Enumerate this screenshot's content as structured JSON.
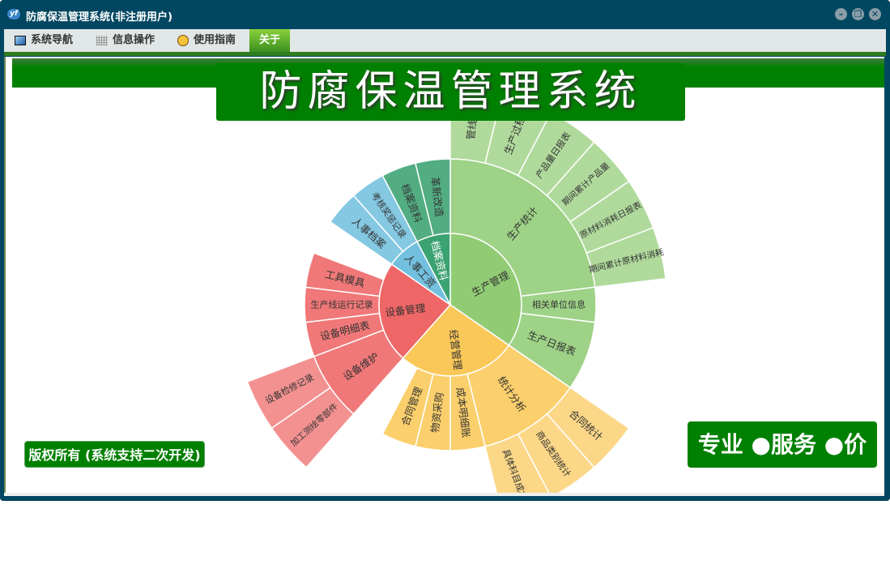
{
  "window": {
    "title": "防腐保温管理系统(非注册用户)",
    "logo": "yf",
    "controls": [
      "minimize-icon",
      "restore-icon",
      "close-icon"
    ]
  },
  "menu": [
    {
      "label": "系统导航",
      "icon": "monitor-icon"
    },
    {
      "label": "信息操作",
      "icon": "grid-icon"
    },
    {
      "label": "使用指南",
      "icon": "help-icon"
    },
    {
      "label": "关于",
      "active": true
    }
  ],
  "banner": {
    "title": "防腐保温管理系统"
  },
  "footer": {
    "copyright": "版权所有 (系统支持二次开发)",
    "slogan": "专业 ●服务 ●价值"
  },
  "colors": {
    "frame": "#024761",
    "green": "#008000"
  },
  "chart_data": {
    "type": "sunburst",
    "start_angle": "top, clockwise",
    "children": [
      {
        "name": "生产管理",
        "value": 9,
        "color": "#91cc75",
        "children": [
          {
            "name": "生产统计",
            "value": 6,
            "children": [
              {
                "name": "管线进",
                "value": 1
              },
              {
                "name": "生产过程",
                "value": 1
              },
              {
                "name": "产品量日报表",
                "value": 1
              },
              {
                "name": "期间累计产品量",
                "value": 1
              },
              {
                "name": "原材料消耗日报表",
                "value": 1
              },
              {
                "name": "期间累计原材料消耗",
                "value": 1
              }
            ]
          },
          {
            "name": "相关单位信息",
            "value": 1
          },
          {
            "name": "生产日报表",
            "value": 2
          }
        ]
      },
      {
        "name": "经营管理",
        "value": 7,
        "color": "#fac858",
        "children": [
          {
            "name": "统计分析",
            "value": 3,
            "children": [
              {
                "name": "合同统计",
                "value": 1
              },
              {
                "name": "商品类别统计",
                "value": 1
              },
              {
                "name": "具体科目成本",
                "value": 1
              }
            ]
          },
          {
            "name": "成本明细账",
            "value": 1
          },
          {
            "name": "物资采购",
            "value": 1
          },
          {
            "name": "合同管理",
            "value": 1
          }
        ]
      },
      {
        "name": "设备管理",
        "value": 6,
        "color": "#ee6666",
        "children": [
          {
            "name": "设备维护",
            "value": 2,
            "children": [
              {
                "name": "加工测绘零部件",
                "value": 1
              },
              {
                "name": "设备检修记录",
                "value": 1
              }
            ]
          },
          {
            "name": "设备明细表",
            "value": 1
          },
          {
            "name": "生产线运行记录",
            "value": 1
          },
          {
            "name": "工具模具",
            "value": 1
          }
        ]
      },
      {
        "name": "人事工资",
        "value": 2,
        "color": "#73c0de",
        "children": [
          {
            "name": "人事档案",
            "value": 1
          },
          {
            "name": "考核奖惩记录",
            "value": 1
          }
        ]
      },
      {
        "name": "档案资料",
        "value": 2,
        "color": "#3ba272",
        "children": [
          {
            "name": "档案资料",
            "value": 1
          },
          {
            "name": "革新改造",
            "value": 1
          }
        ]
      }
    ]
  }
}
